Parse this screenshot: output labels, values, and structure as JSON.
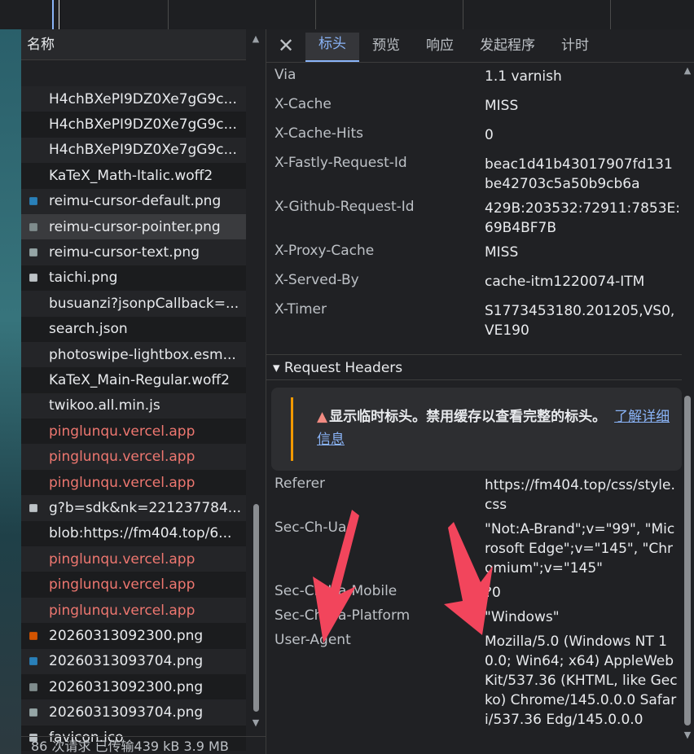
{
  "list": {
    "header": "名称",
    "rows": [
      {
        "name": "H4chBXePI9DZ0Xe7gG9c...",
        "icon": "none"
      },
      {
        "name": "H4chBXePI9DZ0Xe7gG9c...",
        "icon": "none"
      },
      {
        "name": "H4chBXePI9DZ0Xe7gG9c...",
        "icon": "none"
      },
      {
        "name": "KaTeX_Math-Italic.woff2",
        "icon": "none"
      },
      {
        "name": "reimu-cursor-default.png",
        "icon": "image-icon"
      },
      {
        "name": "reimu-cursor-pointer.png",
        "icon": "image-icon"
      },
      {
        "name": "reimu-cursor-text.png",
        "icon": "image-icon"
      },
      {
        "name": "taichi.png",
        "icon": "image-icon"
      },
      {
        "name": "busuanzi?jsonpCallback=...",
        "icon": "none"
      },
      {
        "name": "search.json",
        "icon": "none"
      },
      {
        "name": "photoswipe-lightbox.esm...",
        "icon": "none"
      },
      {
        "name": "KaTeX_Main-Regular.woff2",
        "icon": "none"
      },
      {
        "name": "twikoo.all.min.js",
        "icon": "none"
      },
      {
        "name": "pinglunqu.vercel.app",
        "icon": "none"
      },
      {
        "name": "pinglunqu.vercel.app",
        "icon": "none"
      },
      {
        "name": "pinglunqu.vercel.app",
        "icon": "none"
      },
      {
        "name": "g?b=sdk&nk=221237784...",
        "icon": "image-icon"
      },
      {
        "name": "blob:https://fm404.top/6...",
        "icon": "none"
      },
      {
        "name": "pinglunqu.vercel.app",
        "icon": "none"
      },
      {
        "name": "pinglunqu.vercel.app",
        "icon": "none"
      },
      {
        "name": "pinglunqu.vercel.app",
        "icon": "none"
      },
      {
        "name": "20260313092300.png",
        "icon": "image-icon"
      },
      {
        "name": "20260313093704.png",
        "icon": "image-icon"
      },
      {
        "name": "20260313092300.png",
        "icon": "image-icon"
      },
      {
        "name": "20260313093704.png",
        "icon": "image-icon"
      },
      {
        "name": "favicon.ico",
        "icon": "image-icon"
      }
    ],
    "status": "86 次请求  已传输439 kB  3.9 MB"
  },
  "tabs": [
    "标头",
    "预览",
    "响应",
    "发起程序",
    "计时"
  ],
  "response_headers": [
    {
      "k": "Via",
      "v": "1.1 varnish"
    },
    {
      "k": "X-Cache",
      "v": "MISS"
    },
    {
      "k": "X-Cache-Hits",
      "v": "0"
    },
    {
      "k": "X-Fastly-Request-Id",
      "v": "beac1d41b43017907fd131be42703c5a50b9cb6a"
    },
    {
      "k": "X-Github-Request-Id",
      "v": "429B:203532:72911:7853E:69B4BF7B"
    },
    {
      "k": "X-Proxy-Cache",
      "v": "MISS"
    },
    {
      "k": "X-Served-By",
      "v": "cache-itm1220074-ITM"
    },
    {
      "k": "X-Timer",
      "v": "S1773453180.201205,VS0,VE190"
    }
  ],
  "request_section": "▾ Request Headers",
  "warning": {
    "icon": "warning-icon",
    "text": "显示临时标头。禁用缓存以查看完整的标头。",
    "link": "了解详细",
    "link2": "信息"
  },
  "request_headers": [
    {
      "k": "Referer",
      "v": "https://fm404.top/css/style.css"
    },
    {
      "k": "Sec-Ch-Ua",
      "v": "\"Not:A-Brand\";v=\"99\", \"Microsoft Edge\";v=\"145\", \"Chromium\";v=\"145\""
    },
    {
      "k": "Sec-Ch-Ua-Mobile",
      "v": "?0"
    },
    {
      "k": "Sec-Ch-Ua-Platform",
      "v": "\"Windows\""
    },
    {
      "k": "User-Agent",
      "v": "Mozilla/5.0 (Windows NT 10.0; Win64; x64) AppleWebKit/537.36 (KHTML, like Gecko) Chrome/145.0.0.0 Safari/537.36 Edg/145.0.0.0"
    }
  ],
  "colors": {
    "accent": "#8ab4f8",
    "error_text": "#ee7770",
    "warning": "#f29900",
    "arrow": "#f2455c"
  }
}
